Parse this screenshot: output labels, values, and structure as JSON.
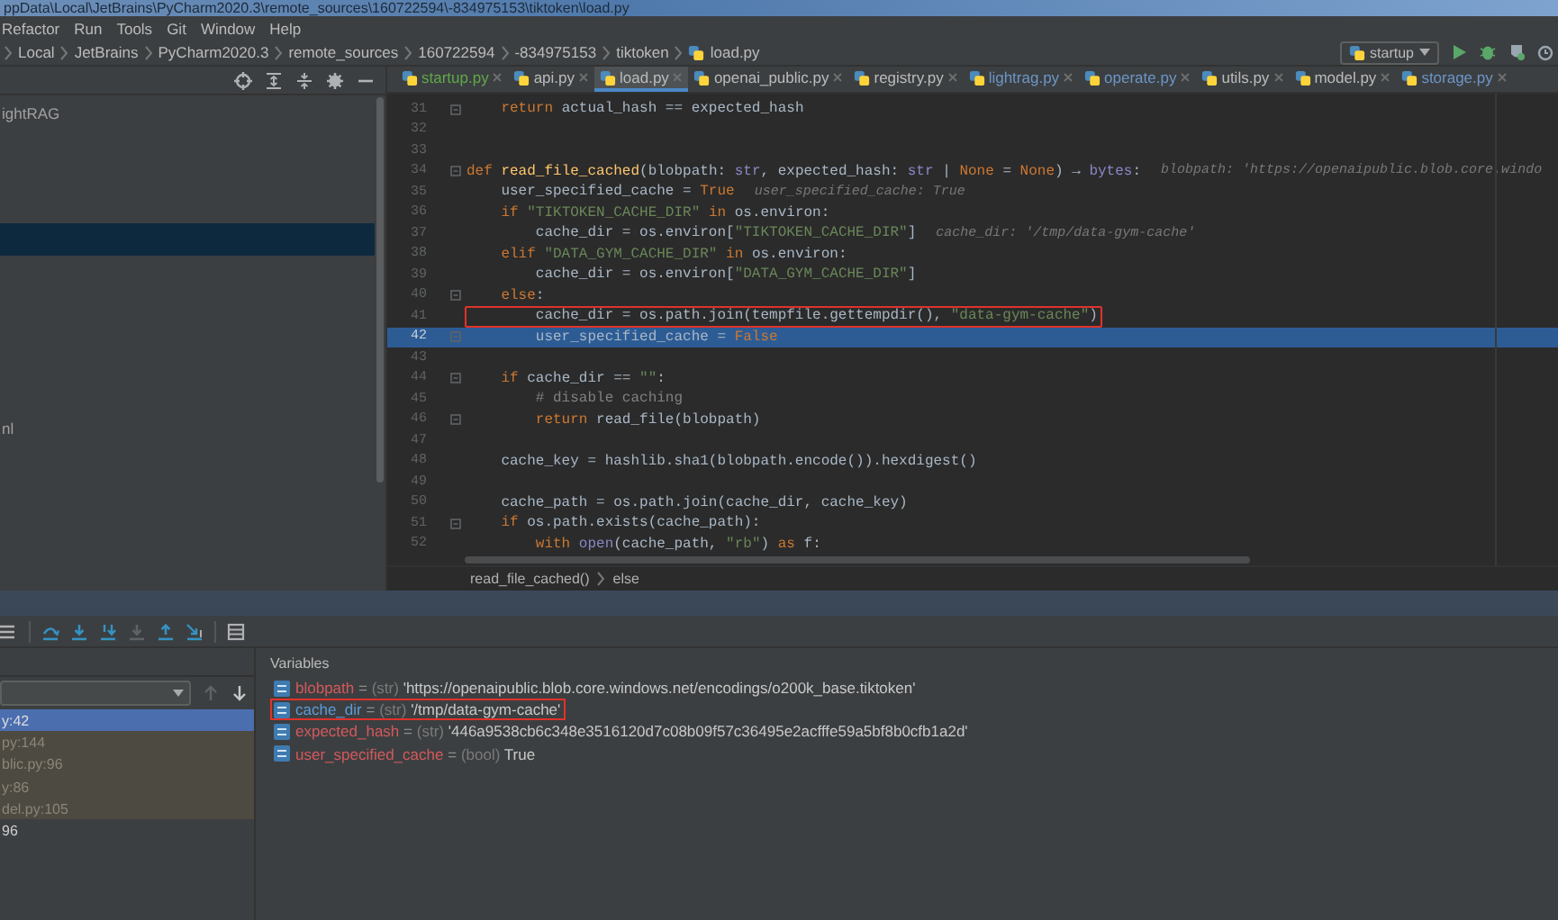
{
  "window": {
    "title": "ppData\\Local\\JetBrains\\PyCharm2020.3\\remote_sources\\160722594\\-834975153\\tiktoken\\load.py"
  },
  "menu": [
    "Refactor",
    "Run",
    "Tools",
    "Git",
    "Window",
    "Help"
  ],
  "breadcrumb": [
    "Local",
    "JetBrains",
    "PyCharm2020.3",
    "remote_sources",
    "160722594",
    "-834975153",
    "tiktoken",
    "load.py"
  ],
  "run_config": {
    "label": "startup"
  },
  "editor_tabs": [
    {
      "label": "startup.py",
      "selected": false,
      "color": "#5fa84a"
    },
    {
      "label": "api.py",
      "selected": false,
      "color": "#bbbbbb"
    },
    {
      "label": "load.py",
      "selected": true,
      "color": "#bbbbbb"
    },
    {
      "label": "openai_public.py",
      "selected": false,
      "color": "#bbbbbb"
    },
    {
      "label": "registry.py",
      "selected": false,
      "color": "#bbbbbb"
    },
    {
      "label": "lightrag.py",
      "selected": false,
      "color": "#6c95c7"
    },
    {
      "label": "operate.py",
      "selected": false,
      "color": "#6c95c7"
    },
    {
      "label": "utils.py",
      "selected": false,
      "color": "#bbbbbb"
    },
    {
      "label": "model.py",
      "selected": false,
      "color": "#bbbbbb"
    },
    {
      "label": "storage.py",
      "selected": false,
      "color": "#6c95c7"
    }
  ],
  "project_tree": {
    "rows": [
      {
        "label": "ightRAG",
        "selected": false
      },
      {
        "selected": false
      },
      {
        "selected": false
      },
      {
        "selected": false
      },
      {
        "selected": true
      },
      {
        "selected": false
      },
      {
        "selected": false
      },
      {
        "selected": false
      },
      {
        "selected": false
      },
      {
        "selected": false
      },
      {
        "label": "nl",
        "selected": false
      }
    ]
  },
  "editor": {
    "lines": [
      {
        "number": "31",
        "fold": true,
        "current": false,
        "boxed": false,
        "tokens": [
          {
            "kind": "kw",
            "text": "    return"
          },
          {
            "kind": "plain",
            "text": " actual_hash == expected_hash"
          }
        ]
      },
      {
        "number": "32",
        "fold": false,
        "current": false,
        "boxed": false
      },
      {
        "number": "33",
        "fold": false,
        "current": false,
        "boxed": false
      },
      {
        "number": "34",
        "fold": true,
        "current": false,
        "boxed": false,
        "tokens": [
          {
            "kind": "kw",
            "text": "def"
          },
          {
            "kind": "fn",
            "text": " read_file_cached"
          },
          {
            "kind": "plain",
            "text": "(blobpath: "
          },
          {
            "kind": "builtin",
            "text": "str"
          },
          {
            "kind": "plain",
            "text": ", expected_hash: "
          },
          {
            "kind": "builtin",
            "text": "str"
          },
          {
            "kind": "plain",
            "text": " | "
          },
          {
            "kind": "kw",
            "text": "None"
          },
          {
            "kind": "plain",
            "text": " = "
          },
          {
            "kind": "kw",
            "text": "None"
          },
          {
            "kind": "plain",
            "text": ") → "
          },
          {
            "kind": "builtin",
            "text": "bytes"
          },
          {
            "kind": "plain",
            "text": ":"
          }
        ],
        "hint": "blobpath: 'https://openaipublic.blob.core.windo"
      },
      {
        "number": "35",
        "fold": false,
        "current": false,
        "boxed": false,
        "tokens": [
          {
            "kind": "plain",
            "text": "    user_specified_cache = "
          },
          {
            "kind": "kw",
            "text": "True"
          }
        ],
        "hint": "user_specified_cache: True"
      },
      {
        "number": "36",
        "fold": false,
        "current": false,
        "boxed": false,
        "tokens": [
          {
            "kind": "kw",
            "text": "    if"
          },
          {
            "kind": "str",
            "text": " \"TIKTOKEN_CACHE_DIR\""
          },
          {
            "kind": "kw",
            "text": " in"
          },
          {
            "kind": "plain",
            "text": " os.environ:"
          }
        ]
      },
      {
        "number": "37",
        "fold": false,
        "current": false,
        "boxed": false,
        "tokens": [
          {
            "kind": "plain",
            "text": "        cache_dir = os.environ["
          },
          {
            "kind": "str",
            "text": "\"TIKTOKEN_CACHE_DIR\""
          },
          {
            "kind": "plain",
            "text": "]"
          }
        ],
        "hint": "cache_dir: '/tmp/data-gym-cache'"
      },
      {
        "number": "38",
        "fold": false,
        "current": false,
        "boxed": false,
        "tokens": [
          {
            "kind": "kw",
            "text": "    elif"
          },
          {
            "kind": "str",
            "text": " \"DATA_GYM_CACHE_DIR\""
          },
          {
            "kind": "kw",
            "text": " in"
          },
          {
            "kind": "plain",
            "text": " os.environ:"
          }
        ]
      },
      {
        "number": "39",
        "fold": false,
        "current": false,
        "boxed": false,
        "tokens": [
          {
            "kind": "plain",
            "text": "        cache_dir = os.environ["
          },
          {
            "kind": "str",
            "text": "\"DATA_GYM_CACHE_DIR\""
          },
          {
            "kind": "plain",
            "text": "]"
          }
        ]
      },
      {
        "number": "40",
        "fold": true,
        "current": false,
        "boxed": false,
        "tokens": [
          {
            "kind": "kw",
            "text": "    else"
          },
          {
            "kind": "plain",
            "text": ":"
          }
        ]
      },
      {
        "number": "41",
        "fold": false,
        "current": false,
        "boxed": true,
        "tokens": [
          {
            "kind": "plain",
            "text": "        cache_dir = os.path.join(tempfile.gettempdir(), "
          },
          {
            "kind": "str",
            "text": "\"data-gym-cache\""
          },
          {
            "kind": "plain",
            "text": ")"
          }
        ]
      },
      {
        "number": "42",
        "fold": true,
        "current": true,
        "boxed": false,
        "tokens": [
          {
            "kind": "plain",
            "text": "        user_specified_cache = "
          },
          {
            "kind": "kw",
            "text": "False"
          }
        ]
      },
      {
        "number": "43",
        "fold": false,
        "current": false,
        "boxed": false
      },
      {
        "number": "44",
        "fold": true,
        "current": false,
        "boxed": false,
        "tokens": [
          {
            "kind": "kw",
            "text": "    if"
          },
          {
            "kind": "plain",
            "text": " cache_dir == "
          },
          {
            "kind": "str",
            "text": "\"\""
          },
          {
            "kind": "plain",
            "text": ":"
          }
        ]
      },
      {
        "number": "45",
        "fold": false,
        "current": false,
        "boxed": false,
        "tokens": [
          {
            "kind": "comment",
            "text": "        # disable caching"
          }
        ]
      },
      {
        "number": "46",
        "fold": true,
        "current": false,
        "boxed": false,
        "tokens": [
          {
            "kind": "kw",
            "text": "        return"
          },
          {
            "kind": "plain",
            "text": " read_file(blobpath)"
          }
        ]
      },
      {
        "number": "47",
        "fold": false,
        "current": false,
        "boxed": false
      },
      {
        "number": "48",
        "fold": false,
        "current": false,
        "boxed": false,
        "tokens": [
          {
            "kind": "plain",
            "text": "    cache_key = hashlib.sha1(blobpath.encode()).hexdigest()"
          }
        ]
      },
      {
        "number": "49",
        "fold": false,
        "current": false,
        "boxed": false
      },
      {
        "number": "50",
        "fold": false,
        "current": false,
        "boxed": false,
        "tokens": [
          {
            "kind": "plain",
            "text": "    cache_path = os.path.join(cache_dir, cache_key)"
          }
        ]
      },
      {
        "number": "51",
        "fold": true,
        "current": false,
        "boxed": false,
        "tokens": [
          {
            "kind": "kw",
            "text": "    if"
          },
          {
            "kind": "plain",
            "text": " os.path.exists(cache_path):"
          }
        ]
      },
      {
        "number": "52",
        "fold": false,
        "current": false,
        "boxed": false,
        "tokens": [
          {
            "kind": "kw",
            "text": "        with"
          },
          {
            "kind": "builtin",
            "text": " open"
          },
          {
            "kind": "plain",
            "text": "(cache_path, "
          },
          {
            "kind": "str",
            "text": "\"rb\""
          },
          {
            "kind": "plain",
            "text": ")"
          },
          {
            "kind": "kw",
            "text": " as"
          },
          {
            "kind": "plain",
            "text": " f:"
          }
        ]
      }
    ],
    "footer": [
      "read_file_cached()",
      "else"
    ]
  },
  "debugger": {
    "frames": [
      {
        "label": "y:42",
        "selected": true,
        "kind": "user"
      },
      {
        "label": "py:144",
        "selected": false,
        "kind": "library"
      },
      {
        "label": "blic.py:96",
        "selected": false,
        "kind": "library"
      },
      {
        "label": "y:86",
        "selected": false,
        "kind": "library"
      },
      {
        "label": "del.py:105",
        "selected": false,
        "kind": "library"
      },
      {
        "label": "96",
        "selected": false,
        "kind": "user"
      }
    ],
    "variables_title": "Variables",
    "variables": [
      {
        "name": "blobpath",
        "op": "=",
        "type": "(str)",
        "value": "'https://openaipublic.blob.core.windows.net/encodings/o200k_base.tiktoken'",
        "color": "#d3595c",
        "boxed": false
      },
      {
        "name": "cache_dir",
        "op": "=",
        "type": "(str)",
        "value": "'/tmp/data-gym-cache'",
        "color": "#5b9bd8",
        "boxed": true
      },
      {
        "name": "expected_hash",
        "op": "=",
        "type": "(str)",
        "value": "'446a9538cb6c348e3516120d7c08b09f57c36495e2acfffe59a5bf8b0cfb1a2d'",
        "color": "#d3595c",
        "boxed": false
      },
      {
        "name": "user_specified_cache",
        "op": "=",
        "type": "(bool)",
        "value": "True",
        "color": "#d3595c",
        "boxed": false
      }
    ]
  }
}
